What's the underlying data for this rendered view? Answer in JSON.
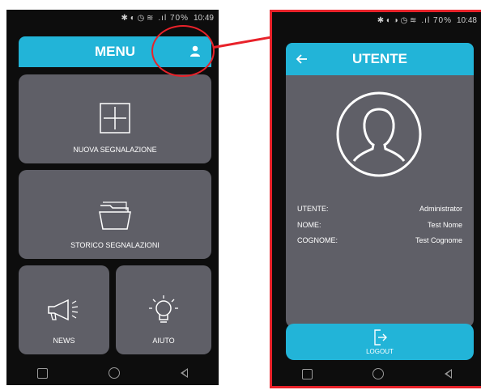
{
  "left_screen": {
    "status": {
      "icons": "✱ ◐ ◷ ≋",
      "signal": ".ıl 70%",
      "time": "10:49"
    },
    "header": {
      "title": "MENU"
    },
    "tiles": [
      {
        "label": "NUOVA SEGNALAZIONE",
        "icon": "plus-box-icon"
      },
      {
        "label": "STORICO SEGNALAZIONI",
        "icon": "folder-icon"
      },
      {
        "label": "NEWS",
        "icon": "megaphone-icon"
      },
      {
        "label": "AIUTO",
        "icon": "lightbulb-icon"
      }
    ]
  },
  "right_screen": {
    "status": {
      "icons": "✱ ◐ ◑ ◷ ≋",
      "signal": ".ıl 70%",
      "time": "10:48"
    },
    "header": {
      "title": "UTENTE"
    },
    "fields": [
      {
        "label": "UTENTE:",
        "value": "Administrator"
      },
      {
        "label": "NOME:",
        "value": "Test Nome"
      },
      {
        "label": "COGNOME:",
        "value": "Test Cognome"
      }
    ],
    "logout_label": "LOGOUT"
  },
  "colors": {
    "accent": "#22b4d8",
    "tile": "#5f5f67",
    "highlight": "#e8222a",
    "background": "#0d0d0d"
  }
}
